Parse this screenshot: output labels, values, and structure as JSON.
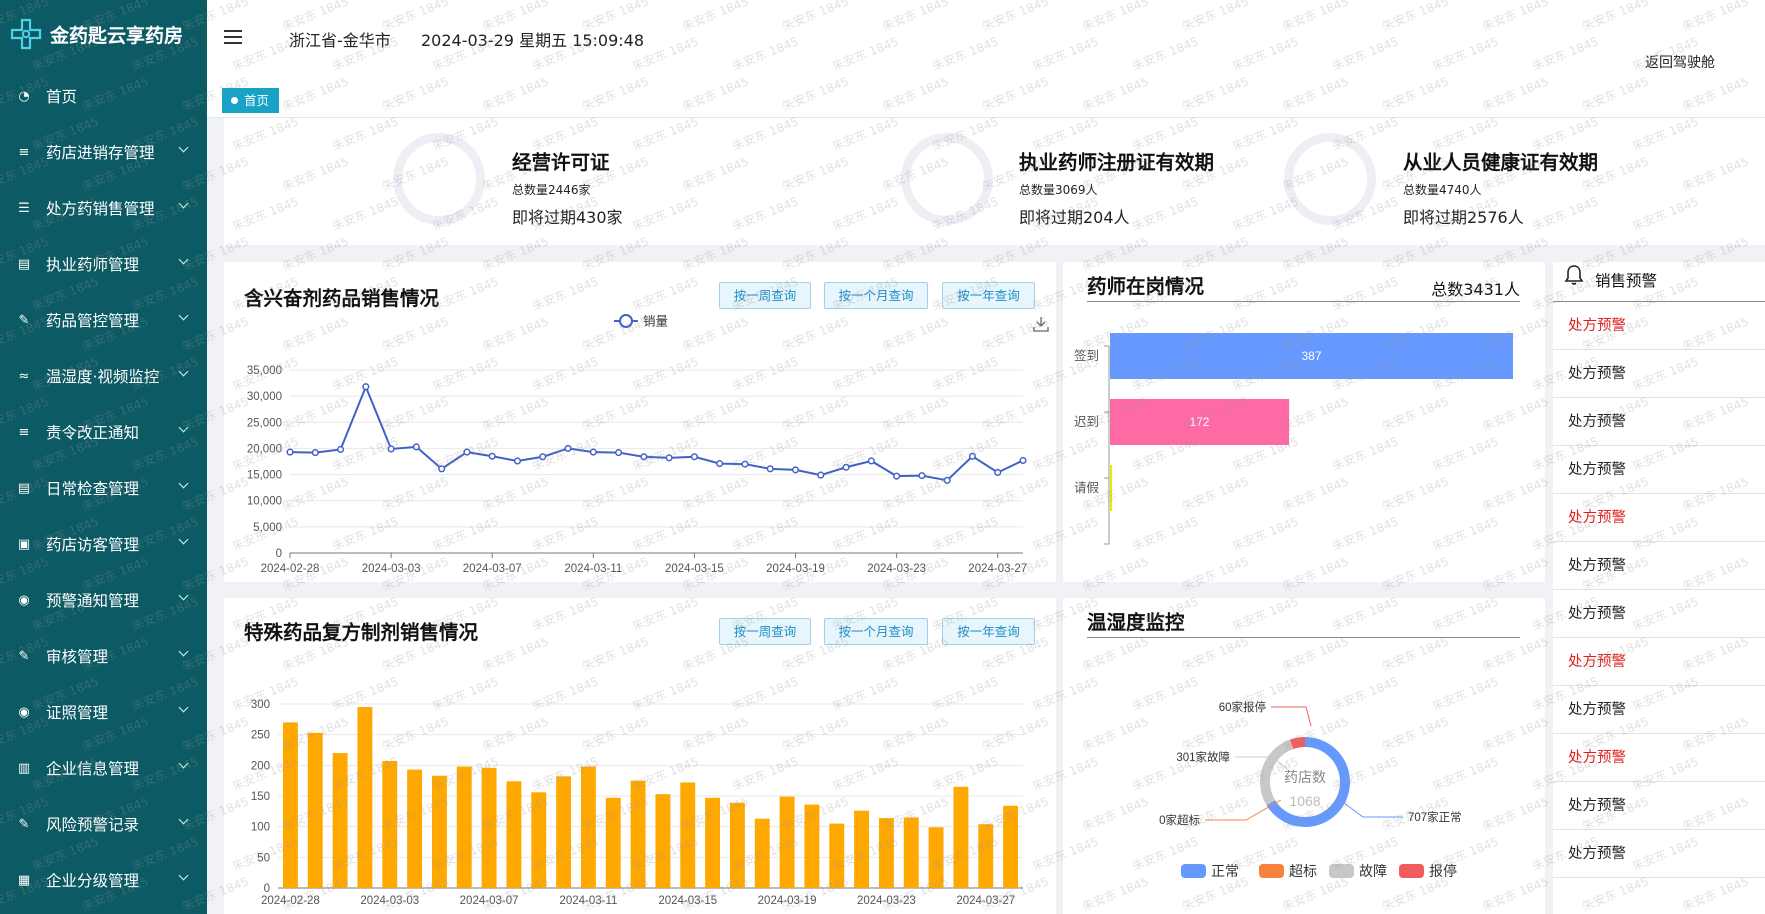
{
  "app": {
    "title": "金药匙云享药房"
  },
  "sidebar": {
    "items": [
      {
        "label": "首页",
        "icon": "dashboard-icon",
        "has_arrow": false
      },
      {
        "label": "药店进销存管理",
        "icon": "layers-icon",
        "has_arrow": true
      },
      {
        "label": "处方药销售管理",
        "icon": "list-icon",
        "has_arrow": true
      },
      {
        "label": "执业药师管理",
        "icon": "document-icon",
        "has_arrow": true
      },
      {
        "label": "药品管控管理",
        "icon": "edit-icon",
        "has_arrow": true
      },
      {
        "label": "温湿度·视频监控",
        "icon": "signal-icon",
        "has_arrow": true
      },
      {
        "label": "责令改正通知",
        "icon": "layers-icon",
        "has_arrow": true
      },
      {
        "label": "日常检查管理",
        "icon": "document-icon",
        "has_arrow": true
      },
      {
        "label": "药店访客管理",
        "icon": "lock-icon",
        "has_arrow": true
      },
      {
        "label": "预警通知管理",
        "icon": "target-icon",
        "has_arrow": true
      },
      {
        "label": "审核管理",
        "icon": "edit-icon",
        "has_arrow": true
      },
      {
        "label": "证照管理",
        "icon": "target-icon",
        "has_arrow": true
      },
      {
        "label": "企业信息管理",
        "icon": "book-icon",
        "has_arrow": true
      },
      {
        "label": "风险预警记录",
        "icon": "edit-icon",
        "has_arrow": true
      },
      {
        "label": "企业分级管理",
        "icon": "building-icon",
        "has_arrow": true
      }
    ]
  },
  "header": {
    "location": "浙江省-金华市",
    "datetime": "2024-03-29 星期五 15:09:48",
    "back_label": "返回驾驶舱"
  },
  "tabs": [
    {
      "label": "首页"
    }
  ],
  "licenses": [
    {
      "title": "经营许可证",
      "total": "总数量2446家",
      "expiring": "即将过期430家"
    },
    {
      "title": "执业药师注册证有效期",
      "total": "总数量3069人",
      "expiring": "即将过期204人"
    },
    {
      "title": "从业人员健康证有效期",
      "total": "总数量4740人",
      "expiring": "即将过期2576人"
    }
  ],
  "panels": {
    "stimulant": {
      "title": "含兴奋剂药品销售情况",
      "buttons": [
        "按一周查询",
        "按一个月查询",
        "按一年查询"
      ],
      "download_icon": "download-icon"
    },
    "special": {
      "title": "特殊药品复方制剂销售情况",
      "buttons": [
        "按一周查询",
        "按一个月查询",
        "按一年查询"
      ]
    },
    "pharmacist": {
      "title": "药师在岗情况",
      "total": "总数3431人"
    },
    "temp": {
      "title": "温湿度监控"
    },
    "alerts": {
      "title": "销售预警",
      "icon": "bell-icon",
      "items": [
        {
          "label": "处方预警",
          "level": "red"
        },
        {
          "label": "处方预警",
          "level": "normal"
        },
        {
          "label": "处方预警",
          "level": "normal"
        },
        {
          "label": "处方预警",
          "level": "normal"
        },
        {
          "label": "处方预警",
          "level": "red"
        },
        {
          "label": "处方预警",
          "level": "normal"
        },
        {
          "label": "处方预警",
          "level": "normal"
        },
        {
          "label": "处方预警",
          "level": "red"
        },
        {
          "label": "处方预警",
          "level": "normal"
        },
        {
          "label": "处方预警",
          "level": "red"
        },
        {
          "label": "处方预警",
          "level": "normal"
        },
        {
          "label": "处方预警",
          "level": "normal"
        }
      ]
    }
  },
  "watermark": "朱安东 1845",
  "colors": {
    "sidebar": "#0c5a64",
    "accent": "#17a2c6",
    "line": "#4261c6",
    "bar": "#ffa800",
    "checkin": "#6699ff",
    "late": "#ff69a4",
    "leave": "#f5e500",
    "alert_red": "#e02020"
  },
  "chart_data": [
    {
      "type": "line",
      "legend": [
        "销量"
      ],
      "categories": [
        "2024-02-28",
        "2024-02-29",
        "2024-03-01",
        "2024-03-02",
        "2024-03-03",
        "2024-03-04",
        "2024-03-05",
        "2024-03-06",
        "2024-03-07",
        "2024-03-08",
        "2024-03-09",
        "2024-03-10",
        "2024-03-11",
        "2024-03-12",
        "2024-03-13",
        "2024-03-14",
        "2024-03-15",
        "2024-03-16",
        "2024-03-17",
        "2024-03-18",
        "2024-03-19",
        "2024-03-20",
        "2024-03-21",
        "2024-03-22",
        "2024-03-23",
        "2024-03-24",
        "2024-03-25",
        "2024-03-26",
        "2024-03-27",
        "2024-03-28"
      ],
      "tick_labels": [
        "2024-02-28",
        "2024-03-03",
        "2024-03-07",
        "2024-03-11",
        "2024-03-15",
        "2024-03-19",
        "2024-03-23",
        "2024-03-27"
      ],
      "series": [
        {
          "name": "销量",
          "values": [
            19300,
            19200,
            19800,
            31800,
            19900,
            20300,
            16100,
            19300,
            18500,
            17600,
            18400,
            20000,
            19300,
            19200,
            18400,
            18200,
            18400,
            17100,
            17000,
            16100,
            15900,
            14900,
            16400,
            17600,
            14700,
            14800,
            13900,
            18500,
            15400,
            17700
          ]
        }
      ],
      "yticks": [
        0,
        5000,
        10000,
        15000,
        20000,
        25000,
        30000,
        35000
      ],
      "ylim": [
        0,
        35000
      ]
    },
    {
      "type": "bar",
      "categories": [
        "2024-02-28",
        "2024-02-29",
        "2024-03-01",
        "2024-03-02",
        "2024-03-03",
        "2024-03-04",
        "2024-03-05",
        "2024-03-06",
        "2024-03-07",
        "2024-03-08",
        "2024-03-09",
        "2024-03-10",
        "2024-03-11",
        "2024-03-12",
        "2024-03-13",
        "2024-03-14",
        "2024-03-15",
        "2024-03-16",
        "2024-03-17",
        "2024-03-18",
        "2024-03-19",
        "2024-03-20",
        "2024-03-21",
        "2024-03-22",
        "2024-03-23",
        "2024-03-24",
        "2024-03-25",
        "2024-03-26",
        "2024-03-27",
        "2024-03-28"
      ],
      "tick_labels": [
        "2024-02-28",
        "2024-03-03",
        "2024-03-07",
        "2024-03-11",
        "2024-03-15",
        "2024-03-19",
        "2024-03-23",
        "2024-03-27"
      ],
      "values": [
        270,
        253,
        220,
        295,
        207,
        193,
        183,
        198,
        196,
        174,
        156,
        182,
        198,
        147,
        175,
        153,
        172,
        147,
        139,
        113,
        149,
        136,
        105,
        126,
        114,
        115,
        99,
        165,
        104,
        134
      ],
      "yticks": [
        0,
        50,
        100,
        150,
        200,
        250,
        300
      ],
      "ylim": [
        0,
        300
      ]
    },
    {
      "type": "bar",
      "orientation": "horizontal",
      "categories": [
        "签到",
        "迟到",
        "请假"
      ],
      "values": [
        387,
        172,
        0
      ],
      "data_labels": [
        "387",
        "172",
        ""
      ]
    },
    {
      "type": "pie",
      "center_label": "药店数",
      "center_value": "1068",
      "slices": [
        {
          "name": "正常",
          "value": 707,
          "label": "707家正常"
        },
        {
          "name": "超标",
          "value": 0,
          "label": "0家超标"
        },
        {
          "name": "故障",
          "value": 301,
          "label": "301家故障"
        },
        {
          "name": "报停",
          "value": 60,
          "label": "60家报停"
        }
      ],
      "legend": [
        "正常",
        "超标",
        "故障",
        "报停"
      ]
    }
  ]
}
